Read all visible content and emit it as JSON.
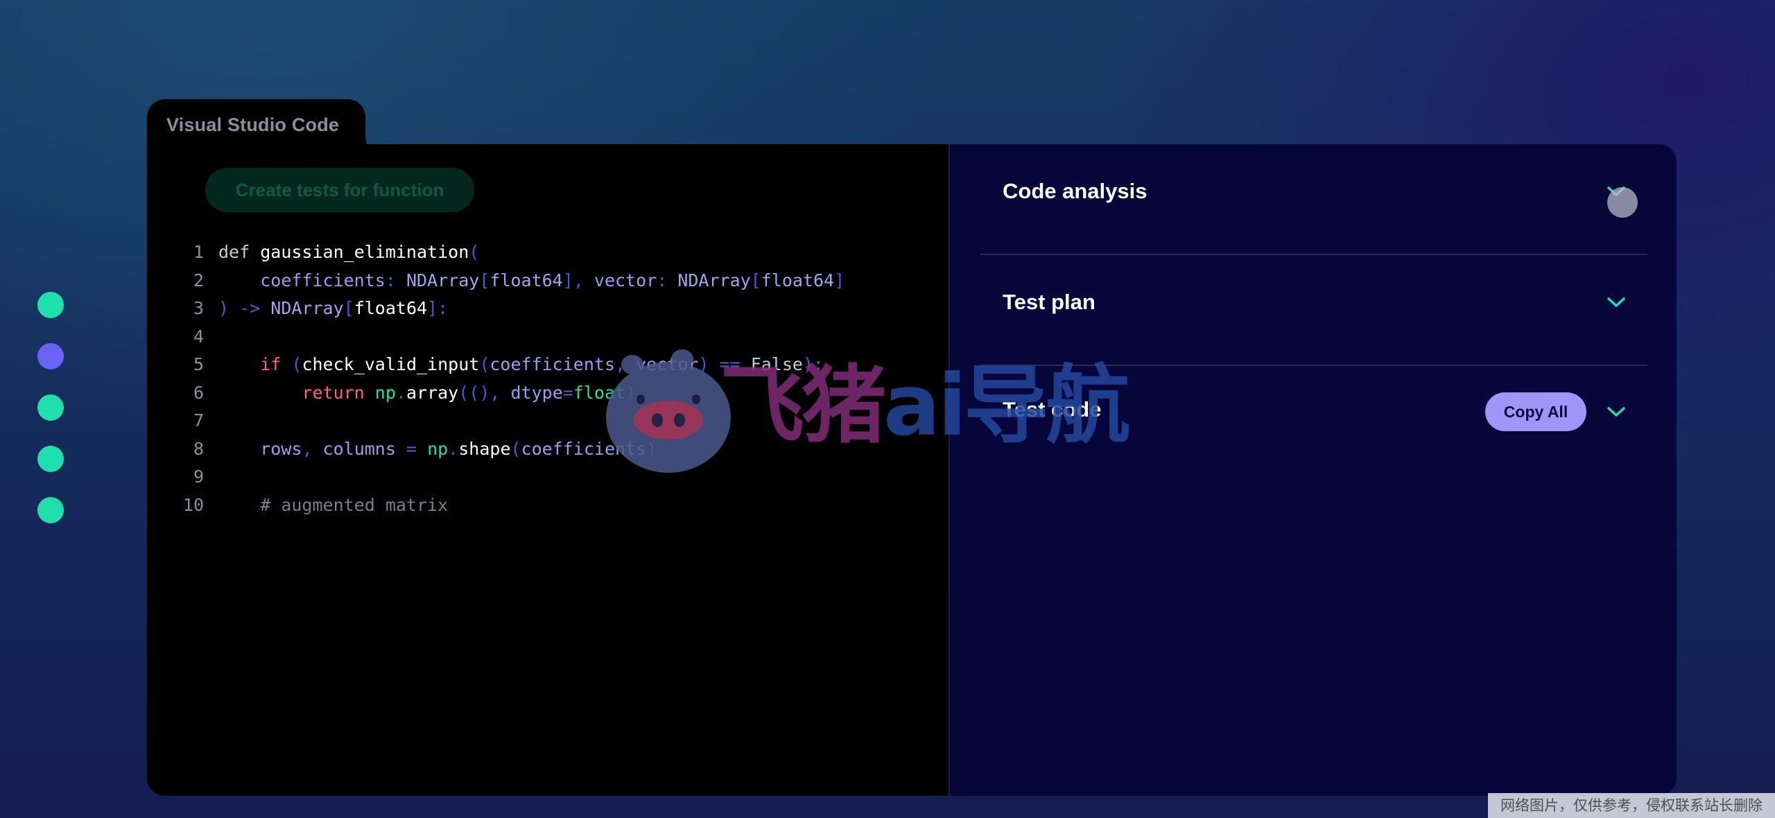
{
  "window": {
    "title": "Visual Studio Code"
  },
  "editor": {
    "action_label": "Create tests for function",
    "lines": [
      {
        "n": "1",
        "tokens": [
          [
            "def ",
            "kw"
          ],
          [
            "gaussian_elimination",
            "fn"
          ],
          [
            "(",
            "p"
          ]
        ]
      },
      {
        "n": "2",
        "tokens": [
          [
            "    ",
            "kw"
          ],
          [
            "coefficients",
            "id"
          ],
          [
            ": ",
            "p"
          ],
          [
            "NDArray",
            "ty"
          ],
          [
            "[",
            "p"
          ],
          [
            "float64",
            "ty"
          ],
          [
            "], ",
            "p"
          ],
          [
            "vector",
            "id"
          ],
          [
            ": ",
            "p"
          ],
          [
            "NDArray",
            "ty"
          ],
          [
            "[",
            "p"
          ],
          [
            "float64",
            "ty"
          ],
          [
            "]",
            "p"
          ]
        ]
      },
      {
        "n": "3",
        "tokens": [
          [
            ") -> ",
            "p"
          ],
          [
            "NDArray",
            "ty"
          ],
          [
            "[",
            "p"
          ],
          [
            "float64",
            "fn"
          ],
          [
            "]:",
            "p"
          ]
        ]
      },
      {
        "n": "4",
        "tokens": []
      },
      {
        "n": "5",
        "tokens": [
          [
            "    ",
            "kw"
          ],
          [
            "if ",
            "red"
          ],
          [
            "(",
            "p"
          ],
          [
            "check_valid_input",
            "fn"
          ],
          [
            "(",
            "p"
          ],
          [
            "coefficients",
            "id"
          ],
          [
            ", ",
            "p"
          ],
          [
            "vector",
            "id"
          ],
          [
            ") == ",
            "p"
          ],
          [
            "False",
            "kw"
          ],
          [
            "):",
            "p"
          ]
        ]
      },
      {
        "n": "6",
        "tokens": [
          [
            "        ",
            "kw"
          ],
          [
            "return ",
            "red"
          ],
          [
            "np",
            "np"
          ],
          [
            ".",
            "p"
          ],
          [
            "array",
            "fn"
          ],
          [
            "((), ",
            "p"
          ],
          [
            "dtype",
            "id"
          ],
          [
            "=",
            "p"
          ],
          [
            "float",
            "np"
          ],
          [
            ")",
            "p"
          ]
        ]
      },
      {
        "n": "7",
        "tokens": []
      },
      {
        "n": "8",
        "tokens": [
          [
            "    ",
            "kw"
          ],
          [
            "rows",
            "id"
          ],
          [
            ", ",
            "p"
          ],
          [
            "columns",
            "id"
          ],
          [
            " = ",
            "p"
          ],
          [
            "np",
            "np"
          ],
          [
            ".",
            "p"
          ],
          [
            "shape",
            "fn"
          ],
          [
            "(",
            "p"
          ],
          [
            "coefficients",
            "id"
          ],
          [
            ")",
            "p"
          ]
        ]
      },
      {
        "n": "9",
        "tokens": []
      },
      {
        "n": "10",
        "tokens": [
          [
            "    ",
            "kw"
          ],
          [
            "# augmented matrix",
            "cm"
          ]
        ]
      }
    ]
  },
  "panel": {
    "sections": [
      {
        "title": "Code analysis",
        "icon": "chevron-down-icon"
      },
      {
        "title": "Test plan",
        "icon": "chevron-down-icon"
      },
      {
        "title": "Test code",
        "icon": "chevron-down-icon",
        "action": "Copy All"
      }
    ]
  },
  "steps": [
    {
      "state": "done"
    },
    {
      "state": "active"
    },
    {
      "state": "done"
    },
    {
      "state": "done"
    },
    {
      "state": "done"
    }
  ],
  "watermark": {
    "main": "飞猪",
    "ai": "ai",
    "tail": "导航"
  },
  "corner_note": "网络图片，仅供参考，侵权联系站长删除",
  "colors": {
    "accent_green": "#1fe0ac",
    "accent_purple": "#6a63f5",
    "copy_button": "#9d97fa",
    "panel_bg": "#06063a",
    "editor_bg": "#000000"
  }
}
